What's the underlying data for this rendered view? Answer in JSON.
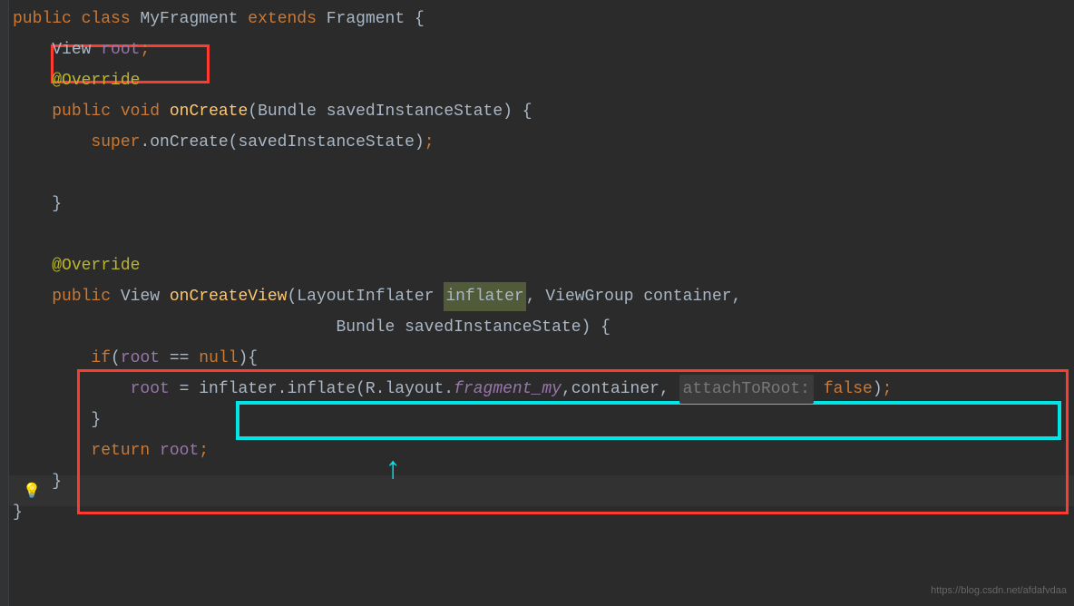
{
  "code": {
    "l1_public": "public",
    "l1_class": "class",
    "l1_name": "MyFragment",
    "l1_extends": "extends",
    "l1_super": "Fragment",
    "l1_brace": " {",
    "l2_type": "View ",
    "l2_field": "root",
    "l2_semi": ";",
    "l3_anno": "@Override",
    "l4_public": "public",
    "l4_void": "void",
    "l4_method": "onCreate",
    "l4_params": "(Bundle savedInstanceState) {",
    "l5_super": "super",
    "l5_call": ".onCreate(savedInstanceState)",
    "l5_semi": ";",
    "l7_close": "}",
    "l9_anno": "@Override",
    "l10_public": "public",
    "l10_ret": "View ",
    "l10_method": "onCreateView",
    "l10_p1a": "(LayoutInflater ",
    "l10_p1b": "inflater",
    "l10_p2": ", ViewGroup container,",
    "l11_params": "Bundle savedInstanceState) {",
    "l12_if": "if",
    "l12_open": "(",
    "l12_field": "root",
    "l12_eq": " == ",
    "l12_null": "null",
    "l12_close": "){",
    "l13_field": "root",
    "l13_assign": " = ",
    "l13_inflater": "inflater.inflate(R.layout.",
    "l13_layout": "fragment_my",
    "l13_comma1": ",container, ",
    "l13_hint": "attachToRoot:",
    "l13_sp": " ",
    "l13_false": "false",
    "l13_end": ")",
    "l13_semi": ";",
    "l14_close": "}",
    "l15_return": "return",
    "l15_sp": " ",
    "l15_field": "root",
    "l15_semi": ";",
    "l16_close": "}",
    "l17_close": "}"
  },
  "icons": {
    "bulb": "💡"
  },
  "watermark": "https://blog.csdn.net/afdafvdaa"
}
